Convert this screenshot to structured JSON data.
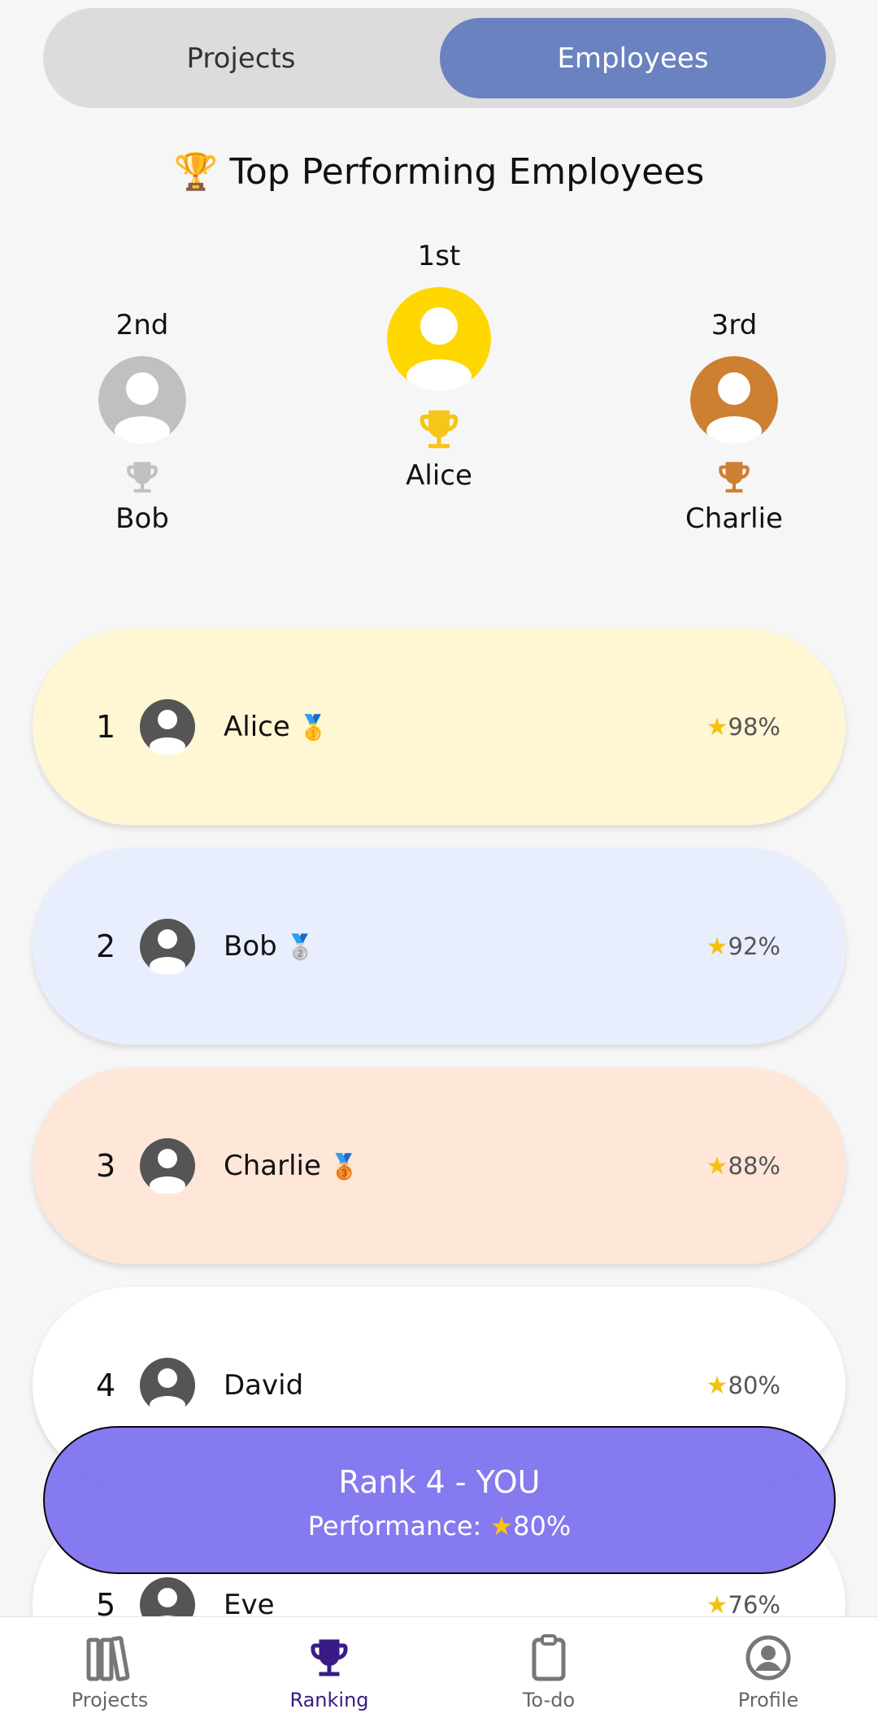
{
  "tabs": {
    "projects": "Projects",
    "employees": "Employees",
    "active": "Employees"
  },
  "heading": {
    "icon": "🏆",
    "title": "Top Performing Employees"
  },
  "podium": {
    "first": {
      "place": "1st",
      "name": "Alice",
      "color": "#ffd700"
    },
    "second": {
      "place": "2nd",
      "name": "Bob",
      "color": "#c0c0c0"
    },
    "third": {
      "place": "3rd",
      "name": "Charlie",
      "color": "#cd7f32"
    }
  },
  "ranking": [
    {
      "rank": "1",
      "name": "Alice",
      "medal": "🥇",
      "score": "98%",
      "bg": "#fff6d4"
    },
    {
      "rank": "2",
      "name": "Bob",
      "medal": "🥈",
      "score": "92%",
      "bg": "#e8eefd"
    },
    {
      "rank": "3",
      "name": "Charlie",
      "medal": "🥉",
      "score": "88%",
      "bg": "#fee6d8"
    },
    {
      "rank": "4",
      "name": "David",
      "medal": "",
      "score": "80%",
      "bg": "#ffffff"
    },
    {
      "rank": "5",
      "name": "Eve",
      "medal": "",
      "score": "76%",
      "bg": "#ffffff"
    }
  ],
  "you_card": {
    "title": "Rank 4 - YOU",
    "performance_label": "Performance:",
    "performance_value": "80%"
  },
  "bottom_nav": [
    {
      "label": "Projects",
      "icon": "books-icon"
    },
    {
      "label": "Ranking",
      "icon": "trophy-icon",
      "active": true
    },
    {
      "label": "To-do",
      "icon": "clipboard-icon"
    },
    {
      "label": "Profile",
      "icon": "account-circle-icon"
    }
  ]
}
